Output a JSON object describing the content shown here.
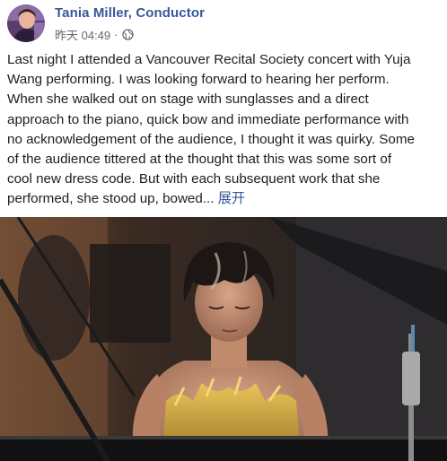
{
  "post": {
    "author": "Tania Miller, Conductor",
    "timestamp": "昨天 04:49",
    "separator": "·",
    "privacy_icon": "globe-icon",
    "text_lines": [
      "Last night I attended a Vancouver Recital Society concert with Yuja",
      "Wang performing. I was looking forward to hearing her perform.",
      "When she walked out on stage with sunglasses and a direct",
      "approach to the piano, quick bow and immediate performance with",
      "no acknowledgement of the audience, I thought it was quirky. Some",
      "of the audience tittered at the thought that this was some sort of",
      "cool new dress code. But with each subsequent work that she",
      "performed, she stood up, bowed..."
    ],
    "expand_label": "展开"
  },
  "colors": {
    "author": "#365899",
    "meta": "#616770",
    "body_text": "#1c1e21",
    "link": "#385898"
  }
}
